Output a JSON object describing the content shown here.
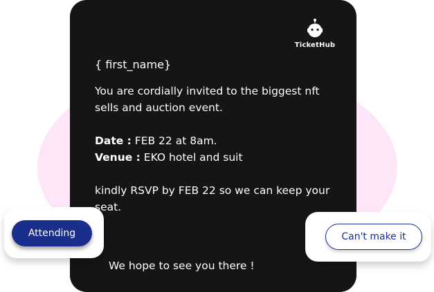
{
  "brand": {
    "name": "TicketHub",
    "icon": "robot-head-icon"
  },
  "invitation": {
    "greeting": "{ first_name}",
    "invite_text": "You are cordially invited to the biggest nft sells and auction event.",
    "date_label": "Date :",
    "date_value": "FEB 22 at 8am.",
    "venue_label": "Venue :",
    "venue_value": "EKO hotel and suit",
    "rsvp_text": "kindly RSVP by FEB 22 so we can keep your seat.",
    "closing": "We hope to see you there !"
  },
  "actions": {
    "attending_label": "Attending",
    "cant_make_it_label": "Can't make it"
  },
  "colors": {
    "card_bg": "#151515",
    "accent": "#1a2e8c",
    "blob": "#fde6f7"
  }
}
